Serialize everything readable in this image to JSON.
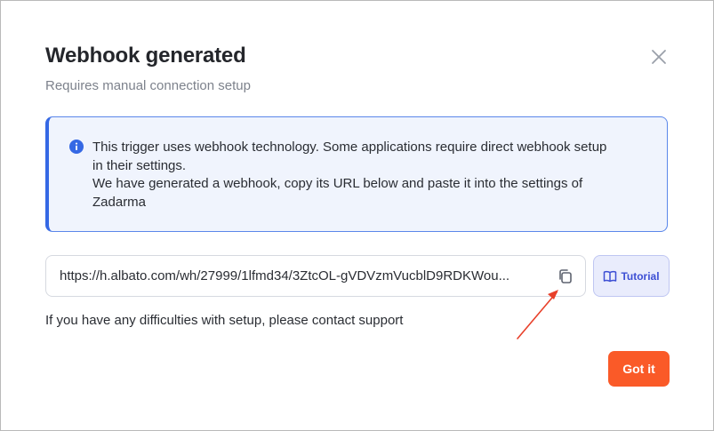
{
  "dialog": {
    "title": "Webhook generated",
    "subtitle": "Requires manual connection setup",
    "close_icon": "close-icon"
  },
  "info": {
    "icon": "info-icon",
    "lines": [
      "This trigger uses webhook technology. Some applications require direct webhook setup",
      "in their settings.",
      "We have generated a webhook, copy its URL below and paste it into the settings of",
      "Zadarma"
    ],
    "accent_color": "#3568e4"
  },
  "webhook": {
    "url": "https://h.albato.com/wh/27999/1lfmd34/3ZtcOL-gVDVzmVucblD9RDKWou...",
    "copy_icon": "copy-icon"
  },
  "tutorial": {
    "label": "Tutorial",
    "icon": "book-icon"
  },
  "help_text": "If you have any difficulties with setup, please contact support",
  "actions": {
    "got_it_label": "Got it",
    "got_it_color": "#fa5a28"
  },
  "annotation": {
    "arrow_color": "#e8402a"
  }
}
